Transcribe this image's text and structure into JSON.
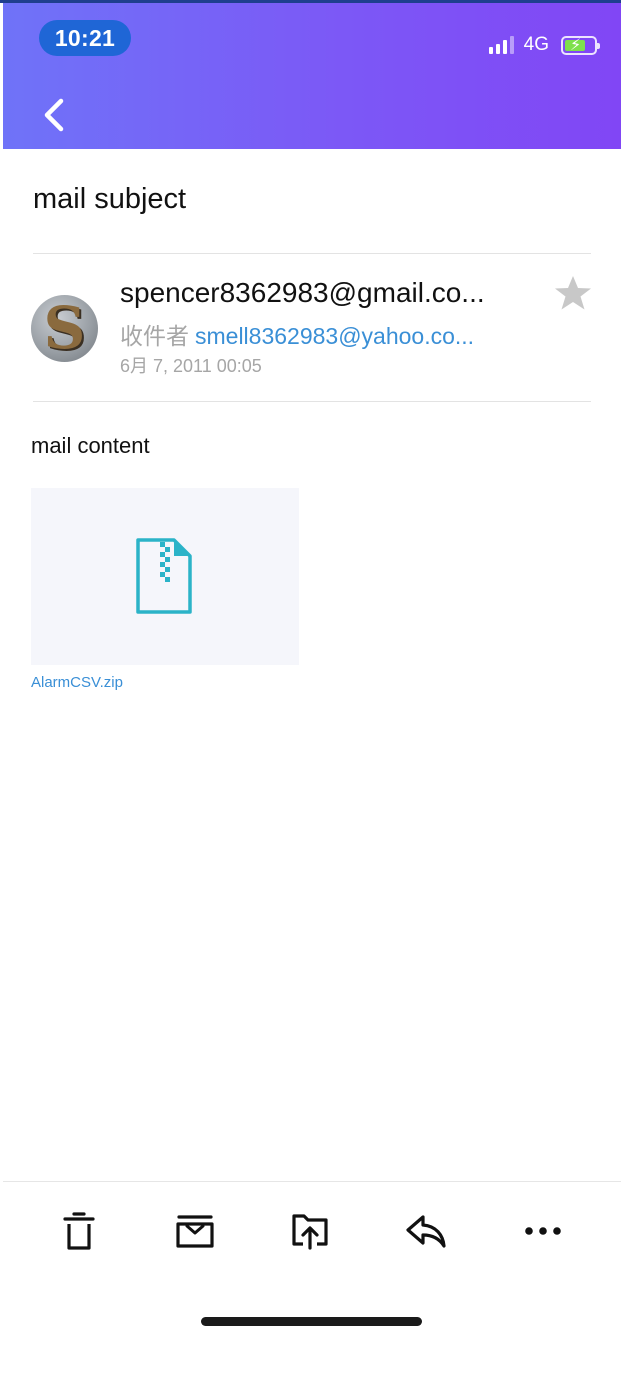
{
  "status_bar": {
    "time": "10:21",
    "network": "4G",
    "signal_bars_active": 3,
    "battery_state": "charging"
  },
  "header": {
    "back_icon": "chevron-left-icon",
    "gradient_colors": [
      "#6f73f8",
      "#8146f5"
    ]
  },
  "mail": {
    "subject": "mail subject",
    "sender": "spencer8362983@gmail.co...",
    "to_label": "收件者",
    "to_address": "smell8362983@yahoo.co...",
    "date": "6月 7, 2011 00:05",
    "avatar_letter": "S",
    "starred": false,
    "content": "mail content",
    "attachment": {
      "name": "AlarmCSV.zip",
      "icon": "zip-file-icon"
    }
  },
  "toolbar": {
    "items": [
      {
        "name": "delete",
        "icon": "trash-icon"
      },
      {
        "name": "archive",
        "icon": "archive-box-icon"
      },
      {
        "name": "move",
        "icon": "folder-upload-icon"
      },
      {
        "name": "reply",
        "icon": "reply-icon"
      },
      {
        "name": "more",
        "icon": "more-dots-icon"
      }
    ]
  },
  "colors": {
    "link": "#3a8fd6",
    "attachment_teal": "#2bb3c8",
    "star_inactive": "#c8c8c8"
  }
}
